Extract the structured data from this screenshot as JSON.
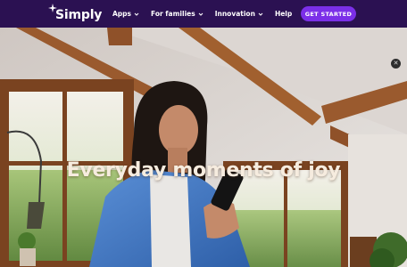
{
  "brand": {
    "name": "Simply",
    "logo_icon": "sparkle-icon"
  },
  "nav": {
    "items": [
      {
        "label": "Apps",
        "has_dropdown": true
      },
      {
        "label": "For families",
        "has_dropdown": true
      },
      {
        "label": "Innovation",
        "has_dropdown": true
      },
      {
        "label": "Help",
        "has_dropdown": false
      }
    ],
    "cta_label": "GET STARTED"
  },
  "hero": {
    "headline": "Everyday moments of joy",
    "close_icon": "close-icon"
  },
  "colors": {
    "nav_bg": "#2b1152",
    "cta_bg": "#7b2fe8",
    "headline": "#f6ecdf"
  }
}
